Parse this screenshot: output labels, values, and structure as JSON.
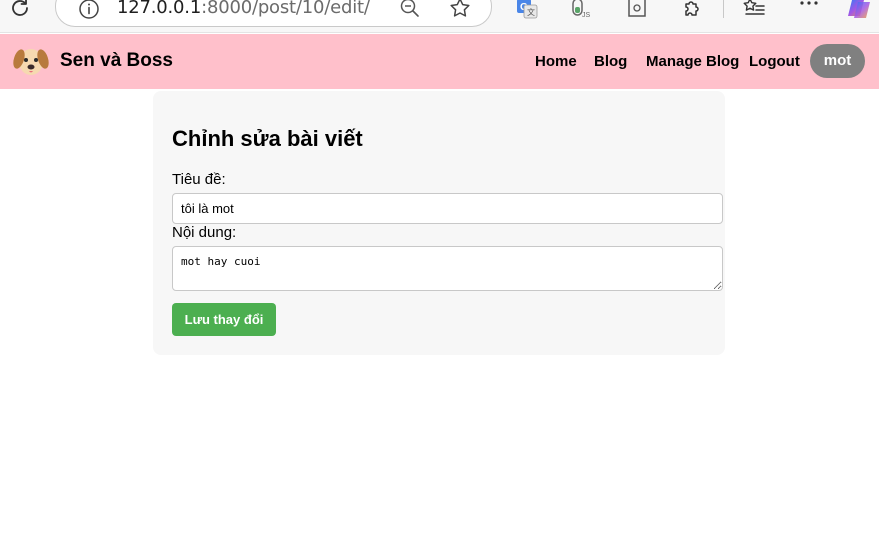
{
  "browser": {
    "url_host": "127.0.0.1",
    "url_rest": ":8000/post/10/edit/",
    "icons": [
      "reload-icon",
      "info-icon",
      "zoom-out-icon",
      "favorite-star-icon",
      "translate-extension-icon",
      "js-extension-icon",
      "calendar-extension-icon",
      "extensions-puzzle-icon",
      "favorites-list-icon",
      "more-menu-icon",
      "copilot-icon"
    ]
  },
  "navbar": {
    "brand": "Sen và Boss",
    "links": [
      "Home",
      "Blog",
      "Manage Blog",
      "Logout"
    ],
    "user": "mot",
    "bg_color": "#ffc0cb"
  },
  "form": {
    "heading": "Chỉnh sửa bài viết",
    "title_label": "Tiêu đề:",
    "title_value": "tôi là mot",
    "content_label": "Nội dung:",
    "content_value": "mot hay cuoi",
    "submit_label": "Lưu thay đổi",
    "submit_color": "#4caf50"
  }
}
